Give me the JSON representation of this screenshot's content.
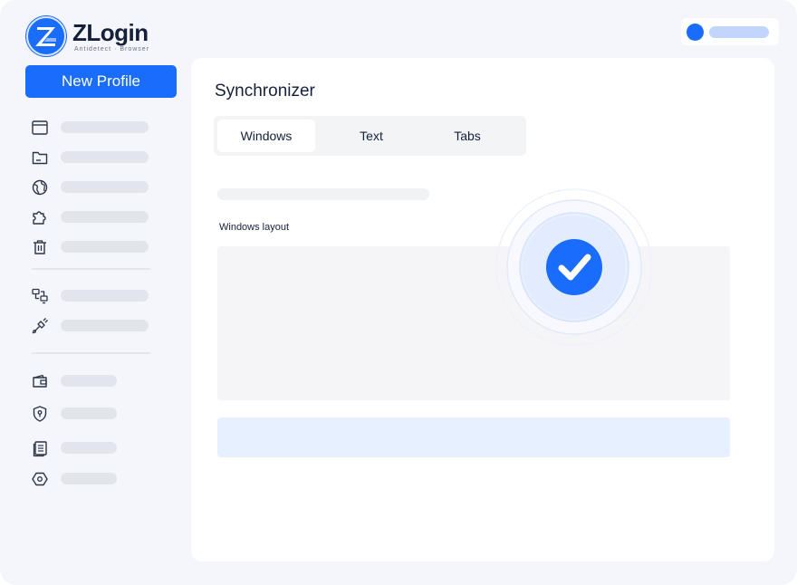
{
  "app": {
    "name": "ZLogin",
    "subtitle": "Antidetect · Browser"
  },
  "sidebar": {
    "new_profile_label": "New Profile",
    "items": [
      {
        "icon": "browser-window-icon"
      },
      {
        "icon": "folder-icon"
      },
      {
        "icon": "globe-icon"
      },
      {
        "icon": "puzzle-extension-icon"
      },
      {
        "icon": "trash-icon"
      },
      {
        "icon": "sync-devices-icon"
      },
      {
        "icon": "plug-connection-icon"
      },
      {
        "icon": "wallet-icon"
      },
      {
        "icon": "security-shield-icon"
      },
      {
        "icon": "documents-icon"
      },
      {
        "icon": "settings-hexagon-icon"
      }
    ]
  },
  "main": {
    "title": "Synchronizer",
    "tabs": [
      {
        "label": "Windows",
        "active": true
      },
      {
        "label": "Text",
        "active": false
      },
      {
        "label": "Tabs",
        "active": false
      }
    ],
    "layout_label": "Windows layout"
  },
  "colors": {
    "accent": "#1a6dfb",
    "background": "#f4f6fb",
    "skeleton": "#e2e5ec",
    "highlight": "#e7f0fe"
  }
}
